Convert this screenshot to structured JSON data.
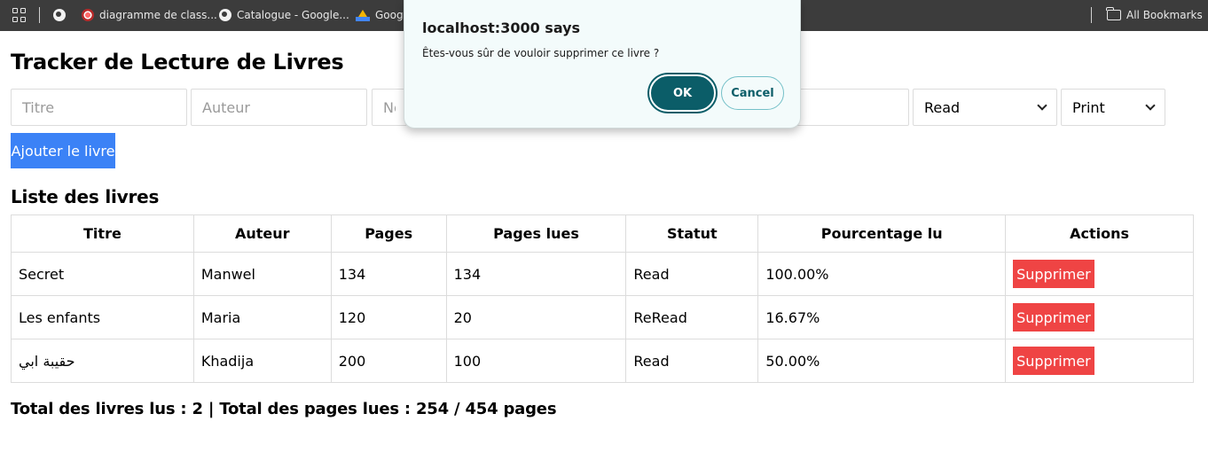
{
  "bookmarks_bar": {
    "items": [
      {
        "label": "diagramme de class...",
        "icon": "diagram-site-icon"
      },
      {
        "label": "Catalogue - Google...",
        "icon": "globe-icon"
      },
      {
        "label": "Googl",
        "icon": "google-drive-icon"
      }
    ],
    "all_bookmarks": "All Bookmarks"
  },
  "page": {
    "title": "Tracker de Lecture de Livres"
  },
  "form": {
    "title_placeholder": "Titre",
    "author_placeholder": "Auteur",
    "pages_placeholder": "Nor",
    "status_value": "Read",
    "format_value": "Print",
    "add_label": "Ajouter le livre"
  },
  "list": {
    "title": "Liste des livres",
    "columns": [
      "Titre",
      "Auteur",
      "Pages",
      "Pages lues",
      "Statut",
      "Pourcentage lu",
      "Actions"
    ],
    "rows": [
      {
        "title": "Secret",
        "author": "Manwel",
        "pages": "134",
        "pages_read": "134",
        "status": "Read",
        "percent": "100.00%",
        "action": "Supprimer"
      },
      {
        "title": "Les enfants",
        "author": "Maria",
        "pages": "120",
        "pages_read": "20",
        "status": "ReRead",
        "percent": "16.67%",
        "action": "Supprimer"
      },
      {
        "title": "حقيبة ابي",
        "author": "Khadija",
        "pages": "200",
        "pages_read": "100",
        "status": "Read",
        "percent": "50.00%",
        "action": "Supprimer"
      }
    ]
  },
  "totals": "Total des livres lus : 2 | Total des pages lues : 254 / 454 pages",
  "dialog": {
    "title": "localhost:3000 says",
    "message": "Êtes-vous sûr de vouloir supprimer ce livre ?",
    "ok": "OK",
    "cancel": "Cancel"
  }
}
